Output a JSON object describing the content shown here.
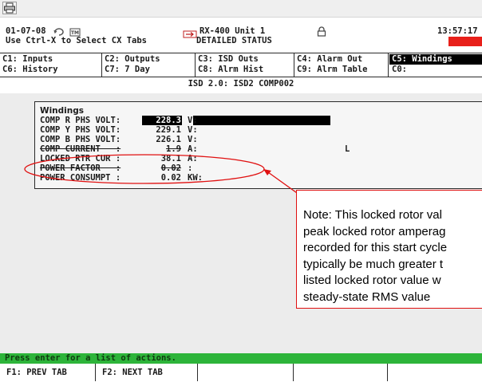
{
  "toolbar": {
    "print_icon": "printer-icon"
  },
  "header": {
    "date": "01-07-08",
    "icon1": "cycle-icon",
    "icon2": "tm-icon",
    "hint": "Use Ctrl-X to Select CX Tabs",
    "unit_icon": "unit-arrow-icon",
    "unit_name": "RX-400 Unit 1",
    "status_title": "DETAILED STATUS",
    "lock_icon": "lock-icon",
    "time": "13:57:17",
    "alarm_color": "#e8201a"
  },
  "tabs": {
    "row1": [
      "C1: Inputs",
      "C2: Outputs",
      "C3: ISD Outs",
      "C4: Alarm Out",
      "C5: Windings"
    ],
    "row2": [
      "C6: History",
      "C7: 7 Day",
      "C8: Alrm Hist",
      "C9: Alrm Table",
      "C0:"
    ],
    "active": "C5: Windings"
  },
  "isd_title": "ISD 2.0: ISD2 COMP002",
  "panel": {
    "title": "Windings",
    "rows": [
      {
        "label": "COMP R PHS VOLT:",
        "value": "228.3",
        "unit": "V:"
      },
      {
        "label": "COMP Y PHS VOLT:",
        "value": "229.1",
        "unit": "V:"
      },
      {
        "label": "COMP B PHS VOLT:",
        "value": "226.1",
        "unit": "V:"
      },
      {
        "label": "COMP CURRENT   :",
        "value": "1.9",
        "unit": "A:",
        "mark": "L"
      },
      {
        "label": "LOCKED RTR CUR :",
        "value": "38.1",
        "unit": "A:"
      },
      {
        "label": "POWER FACTOR   :",
        "value": "0.02",
        "unit": ":"
      },
      {
        "label": "POWER CONSUMPT :",
        "value": "0.02",
        "unit": "KW:"
      }
    ]
  },
  "note": {
    "lines": [
      "Note: This locked rotor val",
      "peak locked rotor amperag",
      "recorded for this start cycle",
      "typically be much greater t",
      "listed locked rotor value w",
      "steady-state RMS value"
    ],
    "color": "#e01010"
  },
  "message": "Press enter for a list of actions.",
  "fkeys": [
    "F1: PREV TAB",
    "F2: NEXT TAB",
    "",
    "",
    ""
  ]
}
